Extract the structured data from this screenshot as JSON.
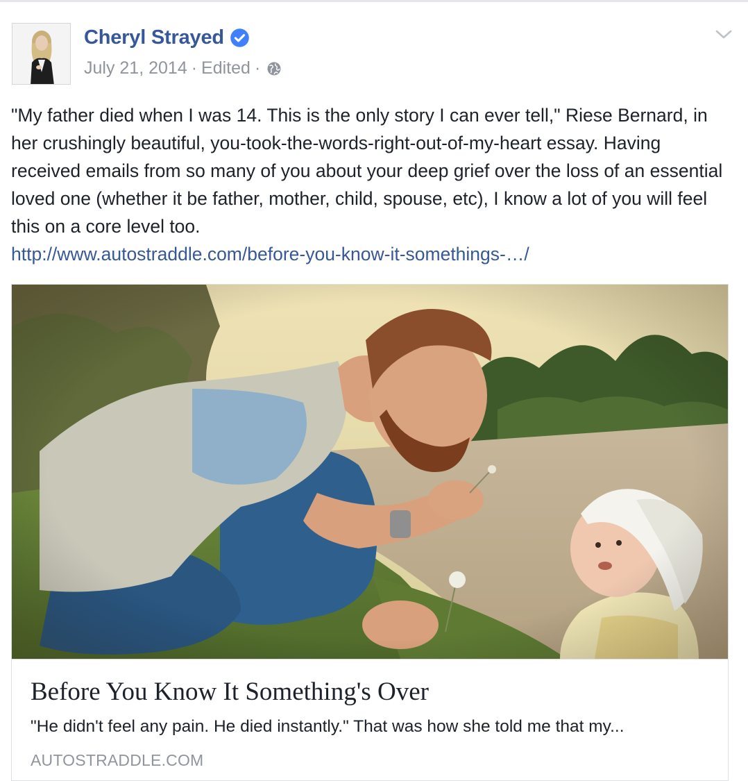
{
  "post": {
    "author_name": "Cheryl Strayed",
    "date": "July 21, 2014",
    "edited_label": "Edited",
    "separator": "·",
    "text": "\"My father died when I was 14. This is the only story I can ever tell,\" Riese Bernard, in her crushingly beautiful, you-took-the-words-right-out-of-my-heart essay. Having received emails from so many of you about your deep grief over the loss of an essential loved one (whether it be father, mother, child, spouse, etc), I know a lot of you will feel this on a core level too.",
    "link_text": "http://www.autostraddle.com/before-you-know-it-somethings-…/"
  },
  "icons": {
    "verified": "verified-badge-icon",
    "privacy": "globe-icon",
    "menu": "chevron-down-icon"
  },
  "link_card": {
    "title": "Before You Know It Something's Over",
    "description": "\"He didn't feel any pain. He died instantly.\" That was how she told me that my...",
    "domain": "AUTOSTRADDLE.COM"
  },
  "colors": {
    "author": "#365899",
    "link": "#365899",
    "meta": "#90949c",
    "verified": "#4080ff",
    "text": "#1d2129"
  }
}
